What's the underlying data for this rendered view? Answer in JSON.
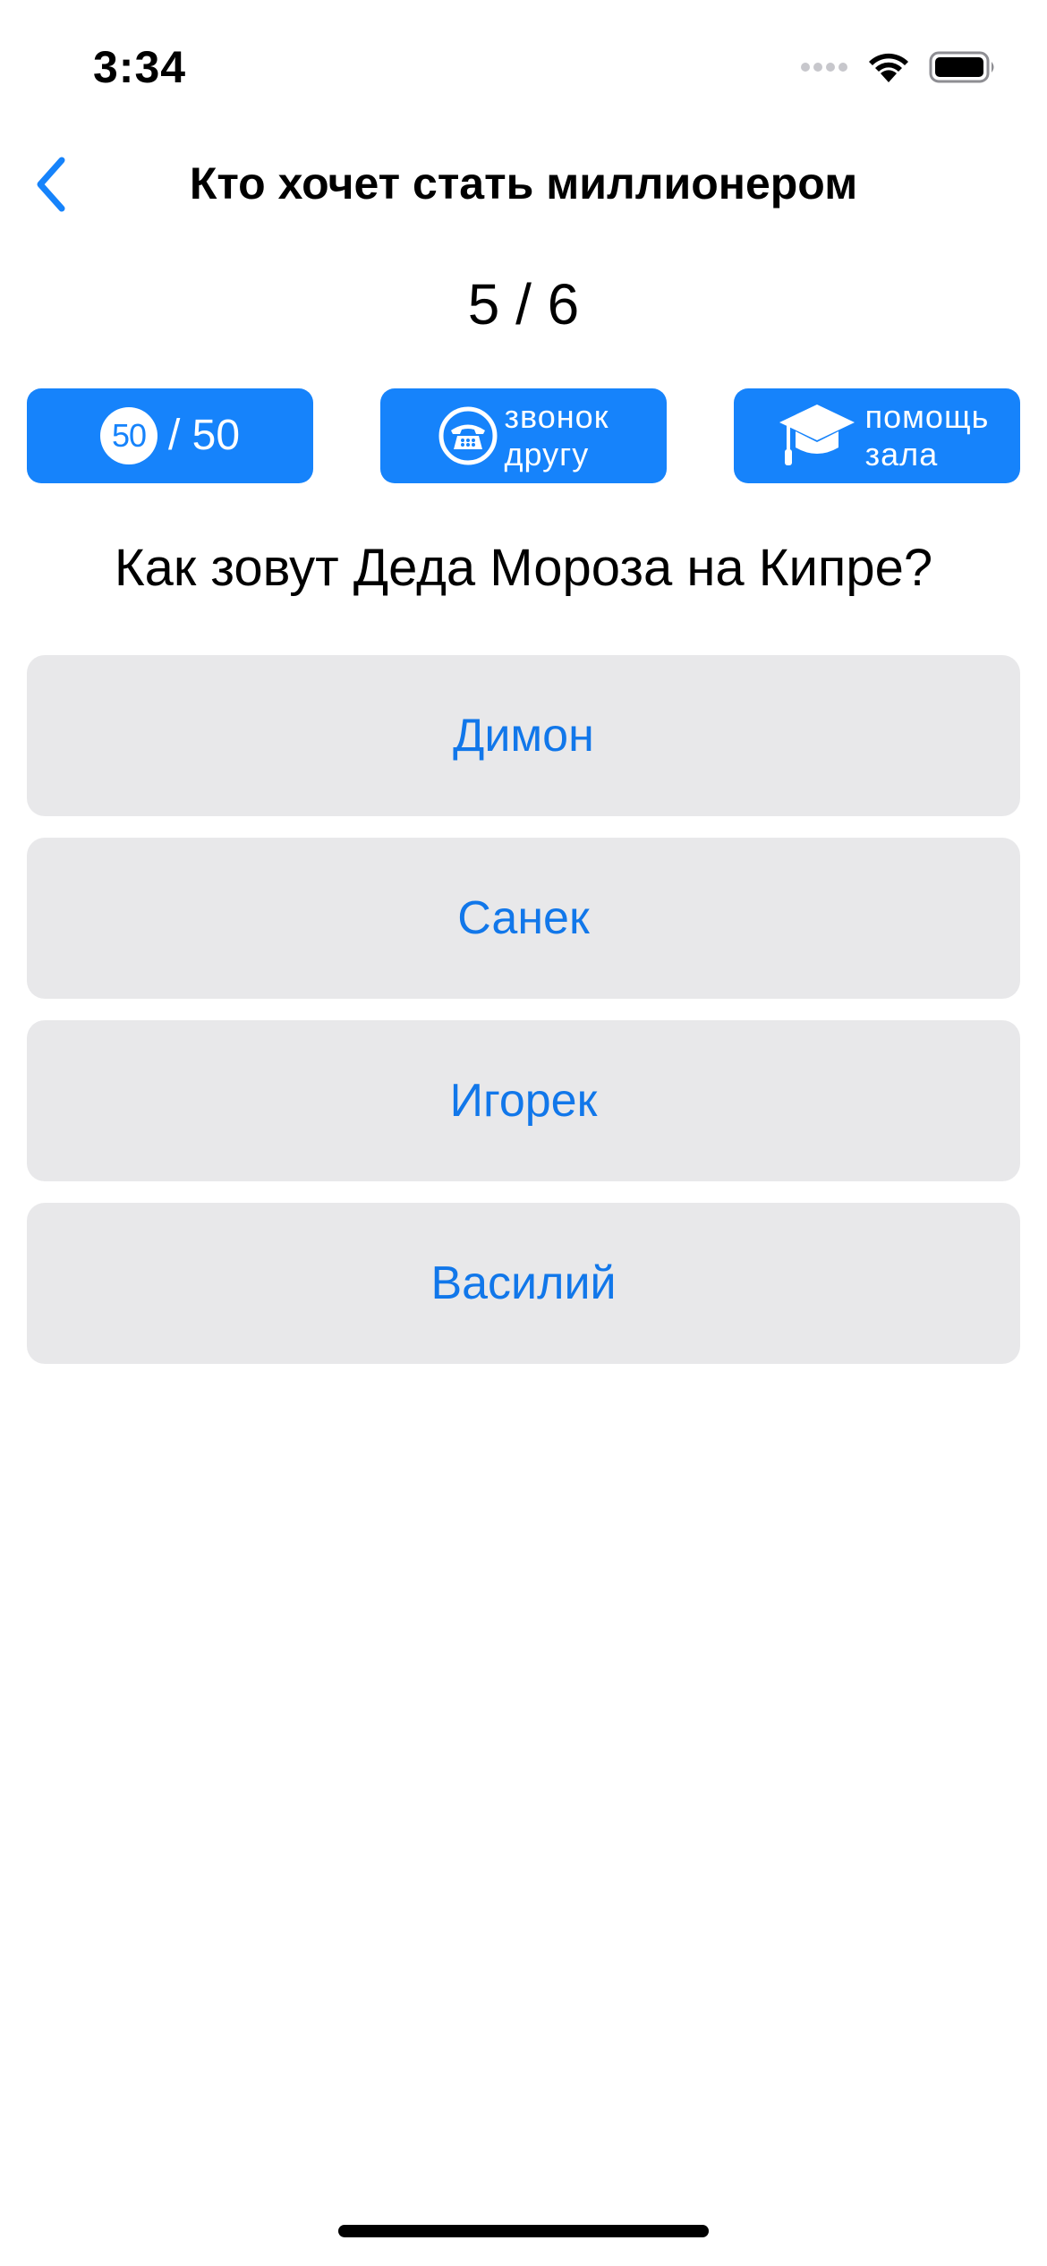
{
  "status_bar": {
    "time": "3:34",
    "icons": [
      "cellular-signal-icon",
      "wifi-icon",
      "battery-icon"
    ]
  },
  "nav": {
    "title": "Кто хочет стать миллионером",
    "back_icon": "chevron-left-icon"
  },
  "progress": {
    "text": "5 / 6",
    "current": 5,
    "total": 6
  },
  "lifelines": {
    "fifty_fifty": {
      "badge": "50",
      "label": "/ 50",
      "icon": "fifty-fifty-badge-icon"
    },
    "call_friend": {
      "label": "звонок\nдругу",
      "icon": "phone-icon"
    },
    "audience": {
      "label": "помощь\nзала",
      "icon": "graduation-cap-icon"
    }
  },
  "question": {
    "text": "Как зовут Деда Мороза на Кипре?"
  },
  "answers": [
    {
      "label": "Димон"
    },
    {
      "label": "Санек"
    },
    {
      "label": "Игорек"
    },
    {
      "label": "Василий"
    }
  ],
  "colors": {
    "accent": "#1683fb",
    "answer_text": "#1177ea",
    "answer_background": "#e8e8ea",
    "background": "#ffffff"
  }
}
